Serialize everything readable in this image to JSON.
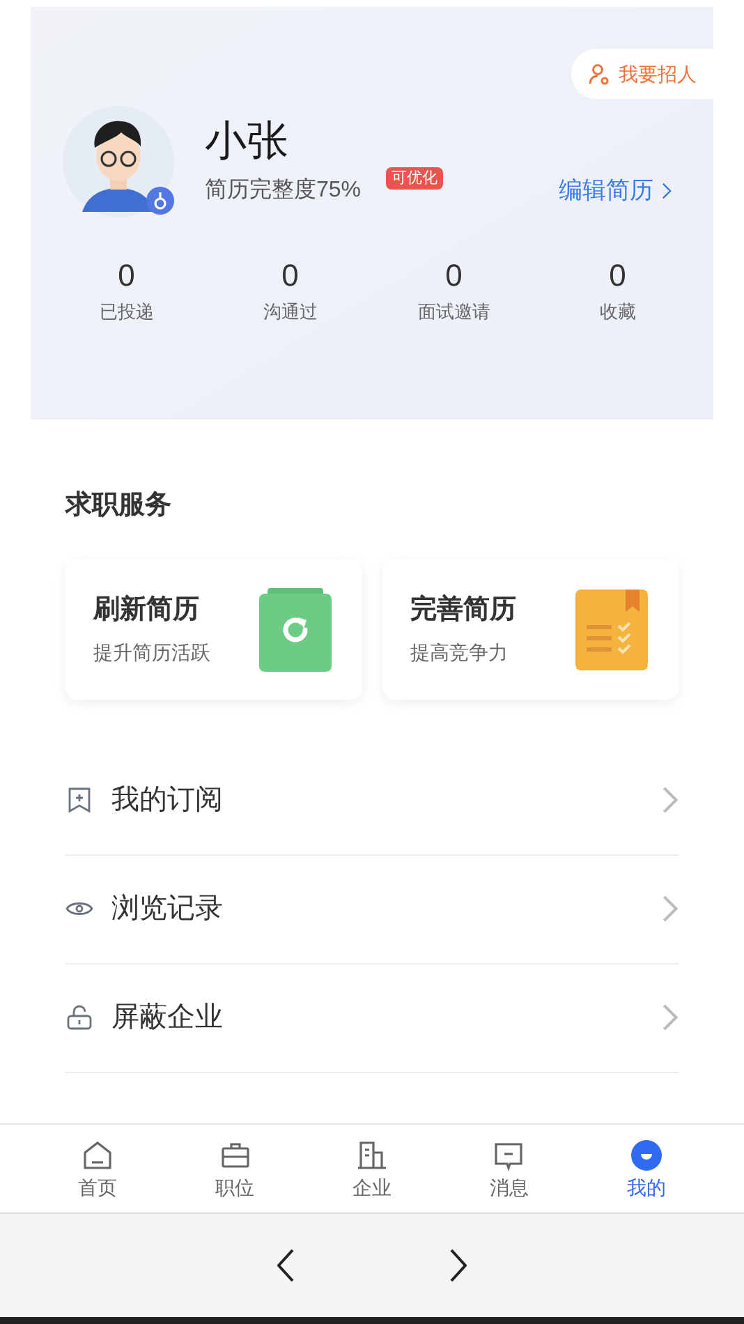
{
  "recruit_button": {
    "label": "我要招人"
  },
  "profile": {
    "name": "小张",
    "completeness": "简历完整度75%",
    "badge": "可优化",
    "edit_link": "编辑简历"
  },
  "stats": [
    {
      "value": "0",
      "label": "已投递"
    },
    {
      "value": "0",
      "label": "沟通过"
    },
    {
      "value": "0",
      "label": "面试邀请"
    },
    {
      "value": "0",
      "label": "收藏"
    }
  ],
  "services": {
    "title": "求职服务",
    "cards": [
      {
        "kind": "refresh",
        "title": "刷新简历",
        "subtitle": "提升简历活跃"
      },
      {
        "kind": "improve",
        "title": "完善简历",
        "subtitle": "提高竞争力"
      }
    ]
  },
  "menu": [
    {
      "kind": "subscribe",
      "label": "我的订阅"
    },
    {
      "kind": "history",
      "label": "浏览记录"
    },
    {
      "kind": "block",
      "label": "屏蔽企业"
    }
  ],
  "tab_bar": [
    {
      "kind": "home",
      "label": "首页",
      "selected": false
    },
    {
      "kind": "jobs",
      "label": "职位",
      "selected": false
    },
    {
      "kind": "company",
      "label": "企业",
      "selected": false
    },
    {
      "kind": "message",
      "label": "消息",
      "selected": false
    },
    {
      "kind": "me",
      "label": "我的",
      "selected": true
    }
  ]
}
